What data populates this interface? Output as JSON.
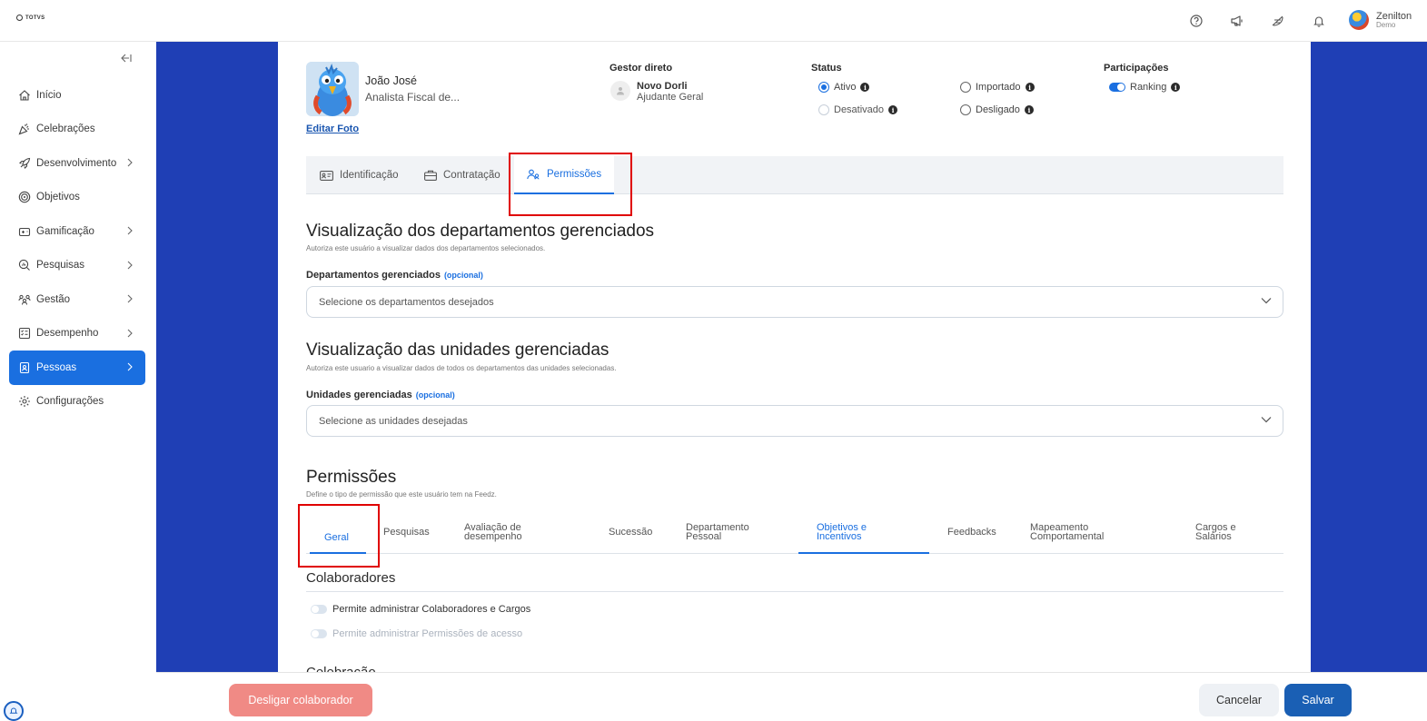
{
  "brand": {
    "logo_text": "TOTVS"
  },
  "topbar": {
    "icons": [
      "help-icon",
      "megaphone-icon",
      "feather-icon",
      "bell-icon"
    ],
    "user_name": "Zenilton",
    "user_role": "Demo"
  },
  "sidebar": {
    "items": [
      {
        "label": "Início",
        "icon": "home-icon",
        "chevron": false
      },
      {
        "label": "Celebrações",
        "icon": "confetti-icon",
        "chevron": false
      },
      {
        "label": "Desenvolvimento",
        "icon": "rocket-icon",
        "chevron": true
      },
      {
        "label": "Objetivos",
        "icon": "target-icon",
        "chevron": false
      },
      {
        "label": "Gamificação",
        "icon": "game-icon",
        "chevron": true
      },
      {
        "label": "Pesquisas",
        "icon": "search-chart-icon",
        "chevron": true
      },
      {
        "label": "Gestão",
        "icon": "people-icon",
        "chevron": true
      },
      {
        "label": "Desempenho",
        "icon": "checklist-icon",
        "chevron": true
      },
      {
        "label": "Pessoas",
        "icon": "person-badge-icon",
        "chevron": true,
        "active": true
      },
      {
        "label": "Configurações",
        "icon": "gear-icon",
        "chevron": false
      }
    ]
  },
  "profile": {
    "name": "João José",
    "role": "Analista Fiscal de...",
    "edit_photo": "Editar Foto",
    "manager_label": "Gestor direto",
    "manager_name": "Novo Dorli",
    "manager_role": "Ajudante Geral",
    "status_label": "Status",
    "status_options": [
      {
        "label": "Ativo",
        "selected": true
      },
      {
        "label": "Importado",
        "selected": false
      },
      {
        "label": "Desativado",
        "selected": false,
        "disabled": true
      },
      {
        "label": "Desligado",
        "selected": false
      }
    ],
    "participations_label": "Participações",
    "ranking_label": "Ranking",
    "ranking_enabled": true
  },
  "tabs": [
    {
      "label": "Identificação",
      "icon": "id-card-icon"
    },
    {
      "label": "Contratação",
      "icon": "briefcase-icon"
    },
    {
      "label": "Permissões",
      "icon": "users-icon",
      "active": true
    }
  ],
  "departments": {
    "title": "Visualização dos departamentos gerenciados",
    "subtitle": "Autoriza este usuário a visualizar dados dos departamentos selecionados.",
    "field_label": "Departamentos gerenciados",
    "optional": "(opcional)",
    "placeholder": "Selecione os departamentos desejados"
  },
  "units": {
    "title": "Visualização das unidades gerenciadas",
    "subtitle": "Autoriza este usuario a visualizar dados de todos os departamentos das unidades selecionadas.",
    "field_label": "Unidades gerenciadas",
    "optional": "(opcional)",
    "placeholder": "Selecione as unidades desejadas"
  },
  "permissions": {
    "title": "Permissões",
    "subtitle": "Define o tipo de permissão que este usuário tem na Feedz.",
    "tabs": [
      {
        "line1": "Geral",
        "line2": "",
        "active": true
      },
      {
        "line1": "Pesquisas",
        "line2": ""
      },
      {
        "line1": "Avaliação de",
        "line2": "desempenho"
      },
      {
        "line1": "Sucessão",
        "line2": ""
      },
      {
        "line1": "Departamento",
        "line2": "Pessoal"
      },
      {
        "line1": "Objetivos e",
        "line2": "Incentivos",
        "highlight": true
      },
      {
        "line1": "Feedbacks",
        "line2": ""
      },
      {
        "line1": "Mapeamento",
        "line2": "Comportamental"
      },
      {
        "line1": "Cargos e",
        "line2": "Salários"
      }
    ],
    "section_colaboradores": "Colaboradores",
    "toggles": [
      {
        "label": "Permite administrar Colaboradores e Cargos",
        "enabled": false,
        "disabled": false
      },
      {
        "label": "Permite administrar Permissões de acesso",
        "enabled": false,
        "disabled": true
      }
    ],
    "section_celebracao": "Celebração"
  },
  "footer": {
    "dismiss_label": "Desligar colaborador",
    "cancel_label": "Cancelar",
    "save_label": "Salvar"
  },
  "colors": {
    "accent": "#1a6fe0",
    "backdrop": "#1f3fb5",
    "danger": "#f08a85",
    "save": "#1a5fb4",
    "highlight_box": "#e00000"
  }
}
